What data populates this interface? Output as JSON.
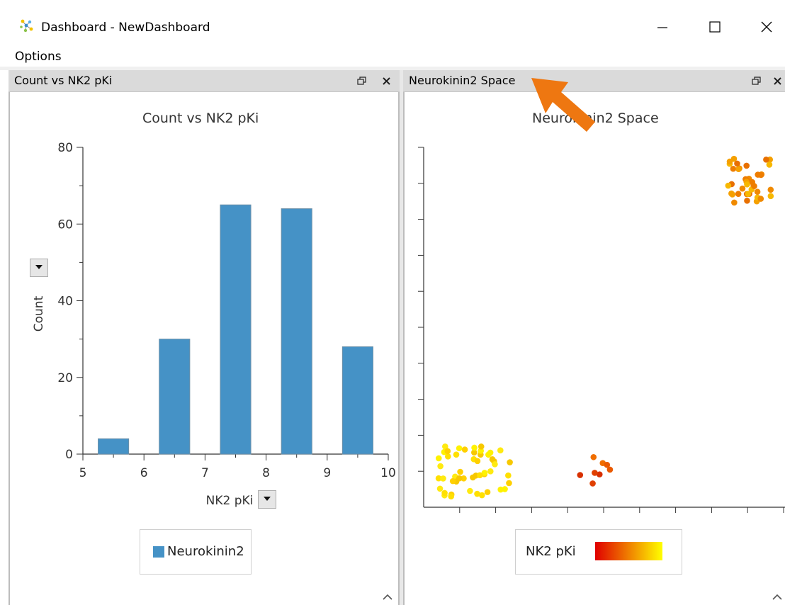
{
  "window": {
    "title": "Dashboard - NewDashboard",
    "buttons": [
      "minimize",
      "maximize",
      "close"
    ],
    "icon": "app-molecule-icon"
  },
  "menu": {
    "options_label": "Options"
  },
  "left_panel": {
    "tab_title": "Count vs NK2 pKi",
    "chart_title": "Count vs NK2 pKi",
    "x_label": "NK2 pKi",
    "y_label": "Count",
    "legend_label": "Neurokinin2",
    "colors": {
      "bar": "#4592c6",
      "bar_border": "#6b8fa8"
    }
  },
  "right_panel": {
    "tab_title": "Neurokinin2 Space",
    "chart_title": "Neurokinin2 Space",
    "legend_label": "NK2 pKi",
    "colors": {
      "gradient_low": "#e00000",
      "gradient_high": "#ffff00"
    }
  },
  "annotation": {
    "arrow_color": "#ee7711",
    "target": "right-panel-tab-title"
  },
  "chart_data": [
    {
      "type": "bar",
      "title": "Count vs NK2 pKi",
      "xlabel": "NK2 pKi",
      "ylabel": "Count",
      "xlim": [
        5,
        10
      ],
      "ylim": [
        0,
        80
      ],
      "xticks": [
        5,
        6,
        7,
        8,
        9,
        10
      ],
      "yticks": [
        0,
        20,
        40,
        60,
        80
      ],
      "bins": [
        [
          5.25,
          5.75
        ],
        [
          6.25,
          6.75
        ],
        [
          7.25,
          7.75
        ],
        [
          8.25,
          8.75
        ],
        [
          9.25,
          9.75
        ]
      ],
      "values": [
        4,
        30,
        65,
        64,
        28
      ],
      "series": [
        {
          "name": "Neurokinin2",
          "values": [
            4,
            30,
            65,
            64,
            28
          ]
        }
      ],
      "legend": "bottom-center",
      "grid": false
    },
    {
      "type": "scatter",
      "title": "Neurokinin2 Space",
      "xlabel": "",
      "ylabel": "",
      "colorbar_label": "NK2 pKi",
      "color_scale": [
        "#e00000",
        "#ffff00"
      ],
      "legend": "bottom-center",
      "grid": false,
      "clusters": [
        {
          "name": "top-right",
          "x_range": [
            8.4,
            9.7
          ],
          "y_range": [
            8.4,
            9.7
          ],
          "approx_points": 40,
          "color": "orange"
        },
        {
          "name": "bottom-left",
          "x_range": [
            0.4,
            2.6
          ],
          "y_range": [
            0.3,
            1.7
          ],
          "approx_points": 50,
          "color": "yellow"
        },
        {
          "name": "bottom-middle",
          "x_range": [
            4.3,
            5.2
          ],
          "y_range": [
            0.6,
            1.4
          ],
          "approx_points": 8,
          "color": "orange-red"
        }
      ]
    }
  ]
}
